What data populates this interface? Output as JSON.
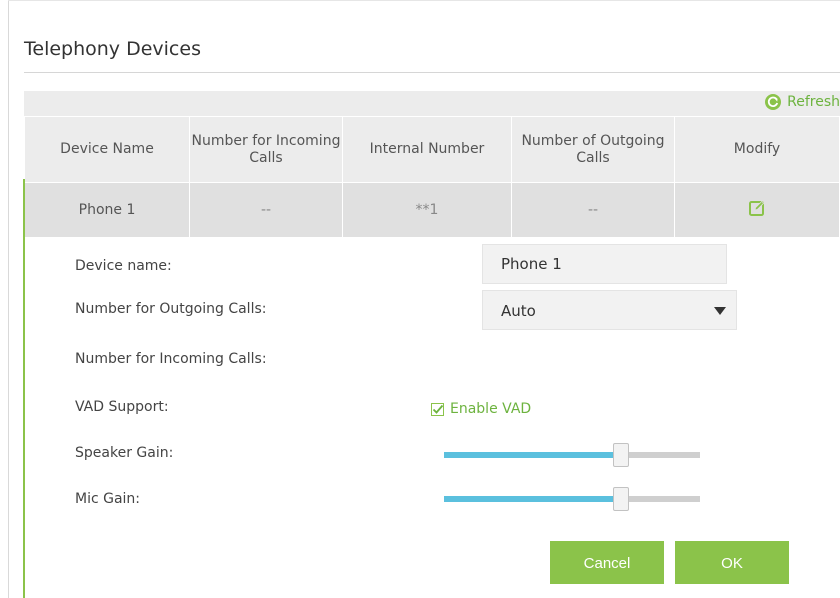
{
  "page": {
    "title": "Telephony Devices"
  },
  "toolbar": {
    "refresh_label": "Refresh"
  },
  "table": {
    "headers": [
      "Device Name",
      "Number for Incoming Calls",
      "Internal Number",
      "Number of Outgoing Calls",
      "Modify"
    ],
    "rows": [
      {
        "device_name": "Phone 1",
        "incoming": "--",
        "internal": "**1",
        "outgoing": "--",
        "modify_icon": "edit-icon"
      }
    ]
  },
  "editor": {
    "device_name_label": "Device name:",
    "device_name_value": "Phone 1",
    "outgoing_label": "Number for Outgoing Calls:",
    "outgoing_value": "Auto",
    "incoming_label": "Number for Incoming Calls:",
    "vad_label": "VAD Support:",
    "vad_checkbox_label": "Enable VAD",
    "vad_checked": true,
    "speaker_gain_label": "Speaker Gain:",
    "speaker_gain_level": 0.69,
    "mic_gain_label": "Mic Gain:",
    "mic_gain_level": 0.69,
    "cancel_label": "Cancel",
    "ok_label": "OK"
  },
  "colors": {
    "accent": "#8bc34a",
    "slider_fill": "#5bc0de",
    "header_bg": "#ececec",
    "row_bg": "#e0e0e0"
  }
}
